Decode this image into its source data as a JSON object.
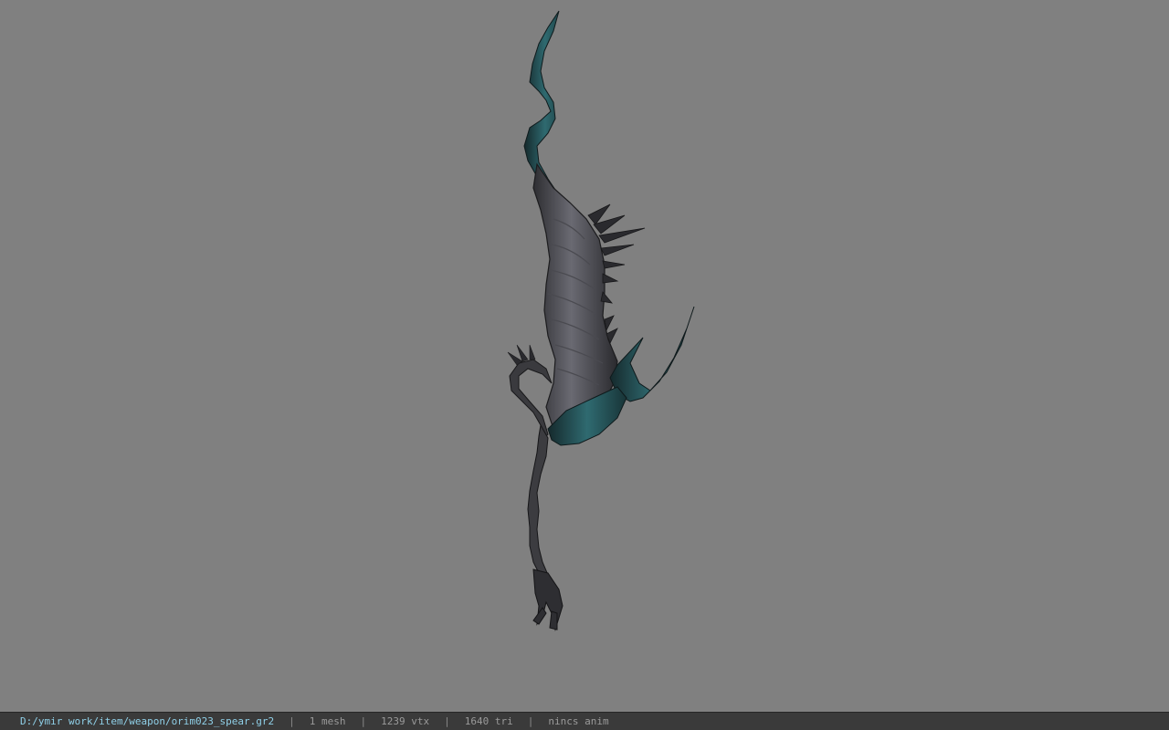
{
  "window": {
    "background_color": "#808080"
  },
  "model": {
    "icon": "spear-model-icon",
    "colors": {
      "blade_teal": "#1f4a4e",
      "body_dark": "#3a3a3e",
      "body_light": "#6a6a72"
    }
  },
  "status": {
    "path": "D:/ymir work/item/weapon/orim023_spear.gr2",
    "separator": "|",
    "mesh": "1 mesh",
    "vtx": "1239 vtx",
    "tri": "1640 tri",
    "anim": "nincs anim",
    "path_color": "#8fd0e8"
  }
}
